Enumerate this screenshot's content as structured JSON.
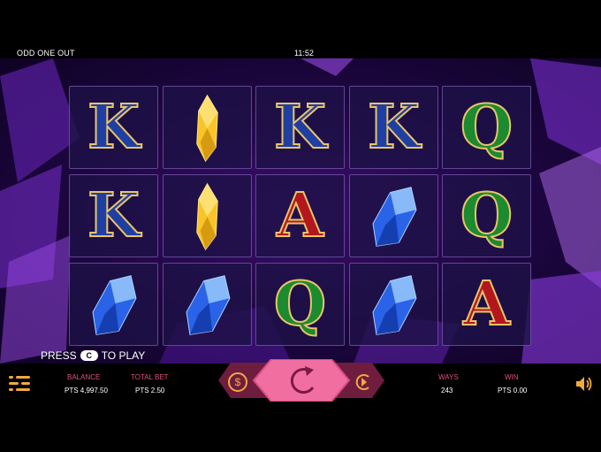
{
  "header": {
    "game_title": "ODD ONE OUT",
    "clock": "11:52"
  },
  "reels": [
    [
      "K",
      "gold-gem",
      "K",
      "K",
      "Q"
    ],
    [
      "K",
      "gold-gem",
      "A",
      "blue-gem",
      "Q"
    ],
    [
      "blue-gem",
      "blue-gem",
      "Q",
      "blue-gem",
      "A"
    ]
  ],
  "prompt": {
    "before": "PRESS",
    "key": "C",
    "after": "TO PLAY"
  },
  "footer": {
    "balance_label": "BALANCE",
    "balance_value": "PTS 4,997.50",
    "bet_label": "TOTAL BET",
    "bet_value": "PTS 2.50",
    "ways_label": "WAYS",
    "ways_value": "243",
    "win_label": "WIN",
    "win_value": "PTS 0.00"
  },
  "icons": {
    "menu": "menu-icon",
    "coin": "coin-icon",
    "spin": "spin-icon",
    "autoplay": "autoplay-icon",
    "sound": "speaker-icon"
  },
  "colors": {
    "accent_pink": "#e0507a",
    "gold": "#e9c46a",
    "k_blue": "#1f3fa3",
    "q_green": "#1c8a2e",
    "a_red": "#b3171d"
  }
}
